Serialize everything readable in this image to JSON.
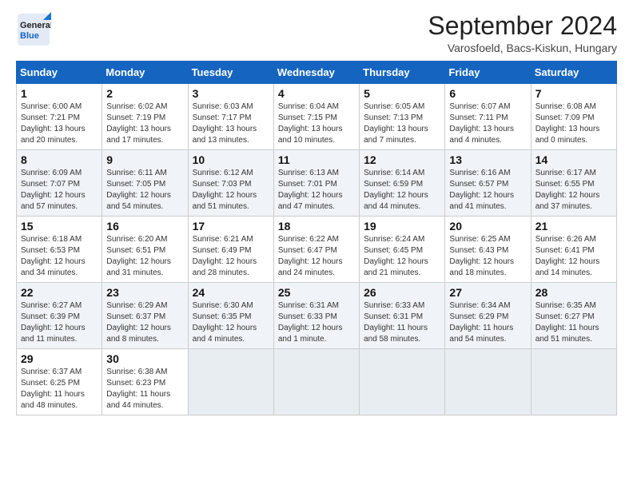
{
  "logo": {
    "line1": "General",
    "line2": "Blue"
  },
  "title": "September 2024",
  "location": "Varosfoeld, Bacs-Kiskun, Hungary",
  "weekdays": [
    "Sunday",
    "Monday",
    "Tuesday",
    "Wednesday",
    "Thursday",
    "Friday",
    "Saturday"
  ],
  "weeks": [
    [
      {
        "day": "1",
        "info": "Sunrise: 6:00 AM\nSunset: 7:21 PM\nDaylight: 13 hours\nand 20 minutes."
      },
      {
        "day": "2",
        "info": "Sunrise: 6:02 AM\nSunset: 7:19 PM\nDaylight: 13 hours\nand 17 minutes."
      },
      {
        "day": "3",
        "info": "Sunrise: 6:03 AM\nSunset: 7:17 PM\nDaylight: 13 hours\nand 13 minutes."
      },
      {
        "day": "4",
        "info": "Sunrise: 6:04 AM\nSunset: 7:15 PM\nDaylight: 13 hours\nand 10 minutes."
      },
      {
        "day": "5",
        "info": "Sunrise: 6:05 AM\nSunset: 7:13 PM\nDaylight: 13 hours\nand 7 minutes."
      },
      {
        "day": "6",
        "info": "Sunrise: 6:07 AM\nSunset: 7:11 PM\nDaylight: 13 hours\nand 4 minutes."
      },
      {
        "day": "7",
        "info": "Sunrise: 6:08 AM\nSunset: 7:09 PM\nDaylight: 13 hours\nand 0 minutes."
      }
    ],
    [
      {
        "day": "8",
        "info": "Sunrise: 6:09 AM\nSunset: 7:07 PM\nDaylight: 12 hours\nand 57 minutes."
      },
      {
        "day": "9",
        "info": "Sunrise: 6:11 AM\nSunset: 7:05 PM\nDaylight: 12 hours\nand 54 minutes."
      },
      {
        "day": "10",
        "info": "Sunrise: 6:12 AM\nSunset: 7:03 PM\nDaylight: 12 hours\nand 51 minutes."
      },
      {
        "day": "11",
        "info": "Sunrise: 6:13 AM\nSunset: 7:01 PM\nDaylight: 12 hours\nand 47 minutes."
      },
      {
        "day": "12",
        "info": "Sunrise: 6:14 AM\nSunset: 6:59 PM\nDaylight: 12 hours\nand 44 minutes."
      },
      {
        "day": "13",
        "info": "Sunrise: 6:16 AM\nSunset: 6:57 PM\nDaylight: 12 hours\nand 41 minutes."
      },
      {
        "day": "14",
        "info": "Sunrise: 6:17 AM\nSunset: 6:55 PM\nDaylight: 12 hours\nand 37 minutes."
      }
    ],
    [
      {
        "day": "15",
        "info": "Sunrise: 6:18 AM\nSunset: 6:53 PM\nDaylight: 12 hours\nand 34 minutes."
      },
      {
        "day": "16",
        "info": "Sunrise: 6:20 AM\nSunset: 6:51 PM\nDaylight: 12 hours\nand 31 minutes."
      },
      {
        "day": "17",
        "info": "Sunrise: 6:21 AM\nSunset: 6:49 PM\nDaylight: 12 hours\nand 28 minutes."
      },
      {
        "day": "18",
        "info": "Sunrise: 6:22 AM\nSunset: 6:47 PM\nDaylight: 12 hours\nand 24 minutes."
      },
      {
        "day": "19",
        "info": "Sunrise: 6:24 AM\nSunset: 6:45 PM\nDaylight: 12 hours\nand 21 minutes."
      },
      {
        "day": "20",
        "info": "Sunrise: 6:25 AM\nSunset: 6:43 PM\nDaylight: 12 hours\nand 18 minutes."
      },
      {
        "day": "21",
        "info": "Sunrise: 6:26 AM\nSunset: 6:41 PM\nDaylight: 12 hours\nand 14 minutes."
      }
    ],
    [
      {
        "day": "22",
        "info": "Sunrise: 6:27 AM\nSunset: 6:39 PM\nDaylight: 12 hours\nand 11 minutes."
      },
      {
        "day": "23",
        "info": "Sunrise: 6:29 AM\nSunset: 6:37 PM\nDaylight: 12 hours\nand 8 minutes."
      },
      {
        "day": "24",
        "info": "Sunrise: 6:30 AM\nSunset: 6:35 PM\nDaylight: 12 hours\nand 4 minutes."
      },
      {
        "day": "25",
        "info": "Sunrise: 6:31 AM\nSunset: 6:33 PM\nDaylight: 12 hours\nand 1 minute."
      },
      {
        "day": "26",
        "info": "Sunrise: 6:33 AM\nSunset: 6:31 PM\nDaylight: 11 hours\nand 58 minutes."
      },
      {
        "day": "27",
        "info": "Sunrise: 6:34 AM\nSunset: 6:29 PM\nDaylight: 11 hours\nand 54 minutes."
      },
      {
        "day": "28",
        "info": "Sunrise: 6:35 AM\nSunset: 6:27 PM\nDaylight: 11 hours\nand 51 minutes."
      }
    ],
    [
      {
        "day": "29",
        "info": "Sunrise: 6:37 AM\nSunset: 6:25 PM\nDaylight: 11 hours\nand 48 minutes."
      },
      {
        "day": "30",
        "info": "Sunrise: 6:38 AM\nSunset: 6:23 PM\nDaylight: 11 hours\nand 44 minutes."
      },
      null,
      null,
      null,
      null,
      null
    ]
  ]
}
